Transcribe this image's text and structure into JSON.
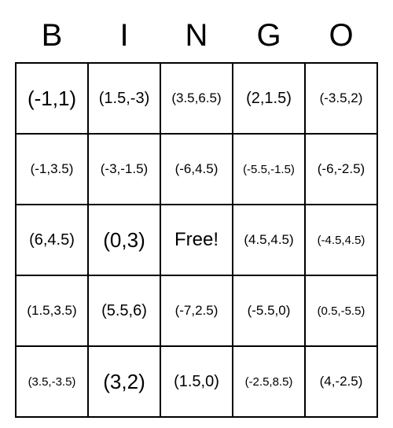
{
  "headers": [
    "B",
    "I",
    "N",
    "G",
    "O"
  ],
  "grid": [
    [
      {
        "text": "(-1,1)",
        "size": "large"
      },
      {
        "text": "(1.5,-3)",
        "size": "med"
      },
      {
        "text": "(3.5,6.5)",
        "size": "small"
      },
      {
        "text": "(2,1.5)",
        "size": "med"
      },
      {
        "text": "(-3.5,2)",
        "size": "small"
      }
    ],
    [
      {
        "text": "(-1,3.5)",
        "size": "small"
      },
      {
        "text": "(-3,-1.5)",
        "size": "small"
      },
      {
        "text": "(-6,4.5)",
        "size": "small"
      },
      {
        "text": "(-5.5,-1.5)",
        "size": "xsmall"
      },
      {
        "text": "(-6,-2.5)",
        "size": "small"
      }
    ],
    [
      {
        "text": "(6,4.5)",
        "size": "med"
      },
      {
        "text": "(0,3)",
        "size": "large"
      },
      {
        "text": "Free!",
        "size": "free"
      },
      {
        "text": "(4.5,4.5)",
        "size": "small"
      },
      {
        "text": "(-4.5,4.5)",
        "size": "xsmall"
      }
    ],
    [
      {
        "text": "(1.5,3.5)",
        "size": "small"
      },
      {
        "text": "(5.5,6)",
        "size": "med"
      },
      {
        "text": "(-7,2.5)",
        "size": "small"
      },
      {
        "text": "(-5.5,0)",
        "size": "small"
      },
      {
        "text": "(0.5,-5.5)",
        "size": "xsmall"
      }
    ],
    [
      {
        "text": "(3.5,-3.5)",
        "size": "xsmall"
      },
      {
        "text": "(3,2)",
        "size": "large"
      },
      {
        "text": "(1.5,0)",
        "size": "med"
      },
      {
        "text": "(-2.5,8.5)",
        "size": "xsmall"
      },
      {
        "text": "(4,-2.5)",
        "size": "small"
      }
    ]
  ]
}
